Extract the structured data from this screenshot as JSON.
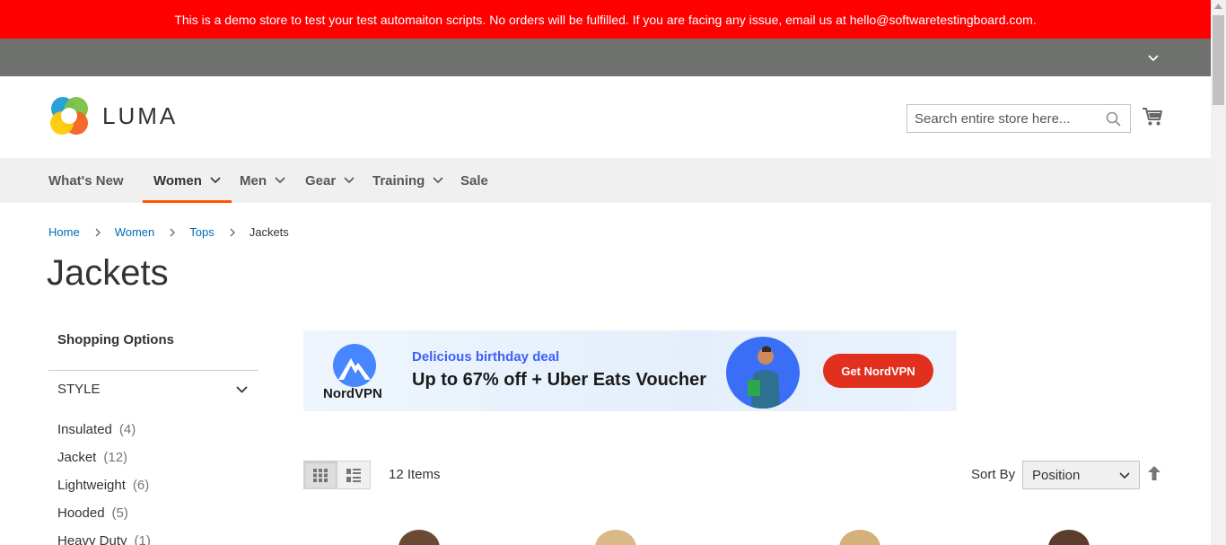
{
  "banner": {
    "text": "This is a demo store to test your test automaiton scripts. No orders will be fulfilled. If you are facing any issue, email us at hello@softwaretestingboard.com.",
    "color": "#ff0000"
  },
  "header": {
    "logo_text": "LUMA",
    "search_placeholder": "Search entire store here...",
    "search_icon": "search-icon",
    "cart_icon": "cart-icon"
  },
  "nav": {
    "items": [
      {
        "label": "What's New",
        "dropdown": false
      },
      {
        "label": "Women",
        "dropdown": true,
        "active": true
      },
      {
        "label": "Men",
        "dropdown": true
      },
      {
        "label": "Gear",
        "dropdown": true
      },
      {
        "label": "Training",
        "dropdown": true
      },
      {
        "label": "Sale",
        "dropdown": false
      }
    ],
    "active_color": "#ff5501"
  },
  "breadcrumbs": {
    "items": [
      "Home",
      "Women",
      "Tops"
    ],
    "current": "Jackets"
  },
  "page_title": "Jackets",
  "sidebar": {
    "title": "Shopping Options",
    "filter": {
      "name": "STYLE",
      "options": [
        {
          "label": "Insulated",
          "count": "(4)"
        },
        {
          "label": "Jacket",
          "count": "(12)"
        },
        {
          "label": "Lightweight",
          "count": "(6)"
        },
        {
          "label": "Hooded",
          "count": "(5)"
        },
        {
          "label": "Heavy Duty",
          "count": "(1)"
        }
      ]
    }
  },
  "ad": {
    "brand": "NordVPN",
    "kicker": "Delicious birthday deal",
    "headline": "Up to 67% off + Uber Eats Voucher",
    "cta": "Get NordVPN",
    "cta_color": "#e1301d"
  },
  "toolbar": {
    "amount": "12 Items",
    "sort_label": "Sort By",
    "sort_value": "Position",
    "view_modes": [
      "grid",
      "list"
    ],
    "active_view": "grid"
  }
}
